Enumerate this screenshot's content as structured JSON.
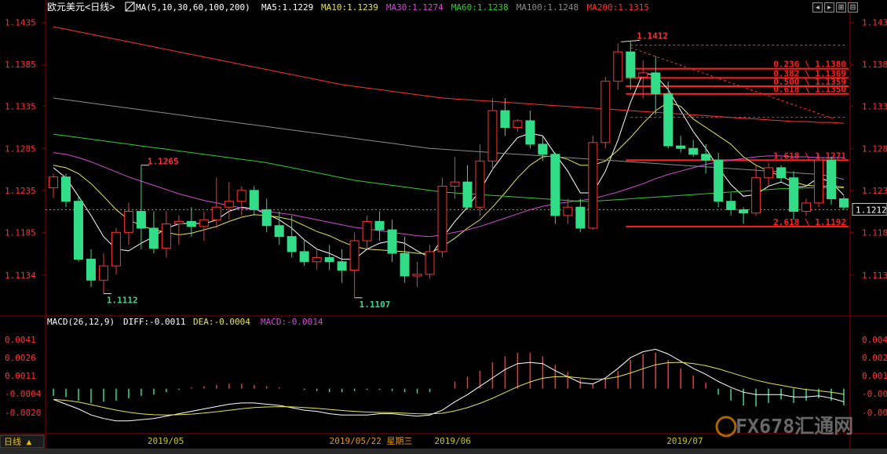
{
  "header": {
    "symbol": "欧元美元",
    "period": "<日线>",
    "ma_label": "MA(5,10,30,60,100,200)",
    "ma_values": [
      {
        "text": "MA5:1.1229",
        "color": "#ffffff"
      },
      {
        "text": "MA10:1.1239",
        "color": "#e6e64c"
      },
      {
        "text": "MA30:1.1274",
        "color": "#d24bd2"
      },
      {
        "text": "MA60:1.1238",
        "color": "#33cc33"
      },
      {
        "text": "MA100:1.1248",
        "color": "#8c8c8c"
      },
      {
        "text": "MA200:1.1315",
        "color": "#ff3232"
      }
    ]
  },
  "window_buttons": [
    "◂",
    "▸",
    "⊞",
    "⊟"
  ],
  "price_axis": {
    "ticks": [
      "1.1435",
      "1.1385",
      "1.1335",
      "1.1285",
      "1.1235",
      "1.1185",
      "1.1134"
    ],
    "current_price": "1.1212"
  },
  "macd_axis": {
    "ticks": [
      "0.0041",
      "0.0026",
      "0.0011",
      "-0.0004",
      "-0.0020"
    ]
  },
  "macd_header": {
    "label": "MACD(26,12,9)",
    "diff": "DIFF:-0.0011",
    "dea": "DEA:-0.0004",
    "macd": "MACD:-0.0014"
  },
  "annotations": {
    "high": "1.1412",
    "low1": "1.1112",
    "low2": "1.1107",
    "peak": "1.1265"
  },
  "fibonacci": [
    {
      "text": "0.236 \\ 1.1380",
      "price": 1.138
    },
    {
      "text": "0.382 \\ 1.1369",
      "price": 1.1369
    },
    {
      "text": "0.500 \\ 1.1359",
      "price": 1.1359
    },
    {
      "text": "0.618 \\ 1.1350",
      "price": 1.135
    },
    {
      "text": "1.618 \\ 1.1271",
      "price": 1.1271
    },
    {
      "text": "2.618 \\ 1.1192",
      "price": 1.1192
    }
  ],
  "date_axis": {
    "labels": [
      "2019/05",
      "2019/05/22  星期三",
      "2019/06",
      "2019/07"
    ]
  },
  "footer": {
    "period_tab": "日线 ▲",
    "watermark": "FX678汇通网"
  },
  "colors": {
    "up": "#ff3232",
    "down": "#33dd88",
    "background": "#000000",
    "grid": "#8b0000",
    "axis_text_left": "#ff3232",
    "axis_text_right": "#ff3232",
    "date_text": "#c8c800",
    "crosshair_date": "#e69900"
  },
  "chart_data": {
    "type": "candlestick",
    "ylim": [
      1.109,
      1.1445
    ],
    "candles": [
      [
        1.1238,
        1.1255,
        1.1226,
        1.1251
      ],
      [
        1.1251,
        1.1255,
        1.1215,
        1.1222
      ],
      [
        1.1222,
        1.1228,
        1.115,
        1.1153
      ],
      [
        1.1153,
        1.1165,
        1.112,
        1.1128
      ],
      [
        1.1128,
        1.116,
        1.1112,
        1.1145
      ],
      [
        1.1145,
        1.119,
        1.1135,
        1.1185
      ],
      [
        1.1185,
        1.122,
        1.117,
        1.121
      ],
      [
        1.121,
        1.1265,
        1.1165,
        1.119
      ],
      [
        1.119,
        1.121,
        1.116,
        1.1166
      ],
      [
        1.1166,
        1.121,
        1.1155,
        1.1195
      ],
      [
        1.1195,
        1.1205,
        1.117,
        1.1198
      ],
      [
        1.1198,
        1.1215,
        1.118,
        1.1192
      ],
      [
        1.1192,
        1.121,
        1.1175,
        1.12
      ],
      [
        1.12,
        1.125,
        1.119,
        1.1215
      ],
      [
        1.1215,
        1.1245,
        1.12,
        1.1222
      ],
      [
        1.1222,
        1.124,
        1.1205,
        1.1235
      ],
      [
        1.1235,
        1.124,
        1.1205,
        1.1212
      ],
      [
        1.1212,
        1.1225,
        1.1185,
        1.1193
      ],
      [
        1.1193,
        1.121,
        1.117,
        1.118
      ],
      [
        1.118,
        1.1205,
        1.1155,
        1.1162
      ],
      [
        1.1162,
        1.1175,
        1.1145,
        1.115
      ],
      [
        1.115,
        1.1165,
        1.114,
        1.1155
      ],
      [
        1.1155,
        1.117,
        1.114,
        1.115
      ],
      [
        1.115,
        1.1165,
        1.1125,
        1.114
      ],
      [
        1.114,
        1.1185,
        1.1107,
        1.1175
      ],
      [
        1.1175,
        1.1205,
        1.1165,
        1.1198
      ],
      [
        1.1198,
        1.121,
        1.1175,
        1.1188
      ],
      [
        1.1188,
        1.12,
        1.115,
        1.116
      ],
      [
        1.116,
        1.118,
        1.1125,
        1.1133
      ],
      [
        1.1133,
        1.115,
        1.112,
        1.1135
      ],
      [
        1.1135,
        1.117,
        1.113,
        1.1162
      ],
      [
        1.1162,
        1.125,
        1.1155,
        1.124
      ],
      [
        1.124,
        1.1275,
        1.1225,
        1.1245
      ],
      [
        1.1245,
        1.1265,
        1.1212,
        1.1215
      ],
      [
        1.1215,
        1.129,
        1.1205,
        1.127
      ],
      [
        1.127,
        1.1345,
        1.126,
        1.133
      ],
      [
        1.133,
        1.1345,
        1.13,
        1.131
      ],
      [
        1.131,
        1.132,
        1.1305,
        1.1318
      ],
      [
        1.1318,
        1.133,
        1.1285,
        1.129
      ],
      [
        1.129,
        1.13,
        1.127,
        1.1278
      ],
      [
        1.1278,
        1.128,
        1.1195,
        1.1205
      ],
      [
        1.1205,
        1.1225,
        1.1195,
        1.1215
      ],
      [
        1.1215,
        1.1225,
        1.1185,
        1.119
      ],
      [
        1.119,
        1.13,
        1.1188,
        1.1292
      ],
      [
        1.1292,
        1.137,
        1.1285,
        1.1365
      ],
      [
        1.1365,
        1.141,
        1.1355,
        1.14
      ],
      [
        1.14,
        1.1412,
        1.1355,
        1.137
      ],
      [
        1.137,
        1.139,
        1.1345,
        1.1375
      ],
      [
        1.1375,
        1.1395,
        1.1325,
        1.135
      ],
      [
        1.135,
        1.1365,
        1.1285,
        1.1288
      ],
      [
        1.1288,
        1.13,
        1.128,
        1.1285
      ],
      [
        1.1285,
        1.1295,
        1.1275,
        1.1278
      ],
      [
        1.1278,
        1.129,
        1.1255,
        1.1271
      ],
      [
        1.1271,
        1.128,
        1.1215,
        1.1222
      ],
      [
        1.1222,
        1.1232,
        1.1205,
        1.1212
      ],
      [
        1.1212,
        1.1215,
        1.1195,
        1.1208
      ],
      [
        1.1208,
        1.1265,
        1.1205,
        1.125
      ],
      [
        1.125,
        1.1268,
        1.124,
        1.1262
      ],
      [
        1.1262,
        1.1265,
        1.1245,
        1.125
      ],
      [
        1.125,
        1.1258,
        1.12,
        1.121
      ],
      [
        1.121,
        1.1225,
        1.1205,
        1.122
      ],
      [
        1.122,
        1.1278,
        1.1215,
        1.1271
      ],
      [
        1.1271,
        1.1275,
        1.1218,
        1.1225
      ],
      [
        1.1225,
        1.1228,
        1.1212,
        1.1215
      ]
    ],
    "ma_lines": [
      {
        "name": "MA5",
        "color": "#ffffff",
        "values": [
          1.1262,
          1.125,
          1.1228,
          1.1205,
          1.118,
          1.1165,
          1.1163,
          1.1172,
          1.118,
          1.119,
          1.1195,
          1.1196,
          1.1195,
          1.12,
          1.121,
          1.1215,
          1.1213,
          1.1207,
          1.12,
          1.119,
          1.1176,
          1.1165,
          1.116,
          1.1153,
          1.1153,
          1.1165,
          1.1172,
          1.1175,
          1.1172,
          1.1163,
          1.1155,
          1.1178,
          1.1198,
          1.1215,
          1.1235,
          1.126,
          1.128,
          1.1298,
          1.1303,
          1.13,
          1.1278,
          1.1258,
          1.1232,
          1.1232,
          1.1258,
          1.1295,
          1.134,
          1.1375,
          1.1372,
          1.1355,
          1.133,
          1.1305,
          1.1285,
          1.1262,
          1.1242,
          1.1228,
          1.123,
          1.124,
          1.1245,
          1.1238,
          1.124,
          1.125,
          1.1245,
          1.1229
        ]
      },
      {
        "name": "MA10",
        "color": "#e6e64c",
        "values": [
          1.1265,
          1.1262,
          1.1255,
          1.1243,
          1.1228,
          1.1212,
          1.12,
          1.1193,
          1.1188,
          1.1185,
          1.1182,
          1.1184,
          1.1188,
          1.1192,
          1.1198,
          1.1203,
          1.1206,
          1.1205,
          1.1203,
          1.12,
          1.1193,
          1.1186,
          1.1181,
          1.1174,
          1.1168,
          1.1165,
          1.1164,
          1.1163,
          1.1162,
          1.116,
          1.116,
          1.1168,
          1.1178,
          1.119,
          1.12,
          1.1215,
          1.1232,
          1.125,
          1.1265,
          1.1275,
          1.1276,
          1.1272,
          1.1265,
          1.1265,
          1.127,
          1.1283,
          1.1298,
          1.1315,
          1.133,
          1.134,
          1.1335,
          1.132,
          1.131,
          1.13,
          1.129,
          1.1275,
          1.1265,
          1.1258,
          1.1252,
          1.1245,
          1.1241,
          1.124,
          1.124,
          1.1239
        ]
      },
      {
        "name": "MA30",
        "color": "#d24bd2",
        "values": [
          1.128,
          1.1278,
          1.1274,
          1.1269,
          1.1263,
          1.1257,
          1.1251,
          1.1246,
          1.1241,
          1.1236,
          1.1231,
          1.1227,
          1.1223,
          1.122,
          1.1217,
          1.1214,
          1.1212,
          1.121,
          1.1208,
          1.1206,
          1.1203,
          1.12,
          1.1197,
          1.1194,
          1.1191,
          1.1189,
          1.1187,
          1.1185,
          1.1183,
          1.1181,
          1.118,
          1.1182,
          1.1185,
          1.1188,
          1.1192,
          1.1197,
          1.1202,
          1.1207,
          1.1212,
          1.1216,
          1.1219,
          1.1221,
          1.1223,
          1.1225,
          1.1229,
          1.1233,
          1.1238,
          1.1243,
          1.1249,
          1.1254,
          1.1258,
          1.1262,
          1.1266,
          1.1269,
          1.1271,
          1.1273,
          1.1275,
          1.1276,
          1.1276,
          1.1275,
          1.1275,
          1.1274,
          1.1274,
          1.1274
        ]
      },
      {
        "name": "MA60",
        "color": "#33cc33",
        "values": [
          1.1302,
          1.13,
          1.1298,
          1.1296,
          1.1294,
          1.1292,
          1.129,
          1.1288,
          1.1286,
          1.1284,
          1.1282,
          1.128,
          1.1278,
          1.1276,
          1.1274,
          1.1272,
          1.127,
          1.1268,
          1.1265,
          1.1262,
          1.1259,
          1.1256,
          1.1253,
          1.125,
          1.1247,
          1.1245,
          1.1243,
          1.1241,
          1.1239,
          1.1237,
          1.1235,
          1.1233,
          1.1232,
          1.1231,
          1.123,
          1.1229,
          1.1228,
          1.1227,
          1.1226,
          1.1225,
          1.1224,
          1.1223,
          1.1222,
          1.1222,
          1.1223,
          1.1224,
          1.1225,
          1.1226,
          1.1227,
          1.1228,
          1.1229,
          1.123,
          1.1231,
          1.1232,
          1.1233,
          1.1234,
          1.1235,
          1.1236,
          1.1237,
          1.1237,
          1.1238,
          1.1238,
          1.1238,
          1.1238
        ]
      },
      {
        "name": "MA100",
        "color": "#8c8c8c",
        "values": [
          1.1345,
          1.1343,
          1.1341,
          1.1339,
          1.1337,
          1.1335,
          1.1333,
          1.1331,
          1.1329,
          1.1327,
          1.1325,
          1.1323,
          1.1321,
          1.1319,
          1.1317,
          1.1315,
          1.1313,
          1.1311,
          1.1309,
          1.1307,
          1.1305,
          1.1303,
          1.1301,
          1.1299,
          1.1297,
          1.1295,
          1.1293,
          1.1291,
          1.1289,
          1.1287,
          1.1285,
          1.1284,
          1.1283,
          1.1282,
          1.1281,
          1.128,
          1.1279,
          1.1278,
          1.1277,
          1.1276,
          1.1275,
          1.1274,
          1.1273,
          1.1272,
          1.1271,
          1.127,
          1.1269,
          1.1268,
          1.1267,
          1.1266,
          1.1265,
          1.1264,
          1.1263,
          1.1262,
          1.1261,
          1.126,
          1.1259,
          1.1258,
          1.1257,
          1.1256,
          1.1255,
          1.1254,
          1.1252,
          1.1248
        ]
      },
      {
        "name": "MA200",
        "color": "#ff3232",
        "values": [
          1.143,
          1.1427,
          1.1424,
          1.1421,
          1.1418,
          1.1415,
          1.1412,
          1.1409,
          1.1406,
          1.1403,
          1.14,
          1.1397,
          1.1394,
          1.1391,
          1.1388,
          1.1385,
          1.1382,
          1.1379,
          1.1376,
          1.1373,
          1.137,
          1.1367,
          1.1364,
          1.1361,
          1.1359,
          1.1357,
          1.1355,
          1.1353,
          1.1351,
          1.1349,
          1.1347,
          1.1345,
          1.1344,
          1.1343,
          1.1342,
          1.1341,
          1.134,
          1.1339,
          1.1338,
          1.1337,
          1.1336,
          1.1335,
          1.1334,
          1.1333,
          1.1332,
          1.1331,
          1.133,
          1.1329,
          1.1328,
          1.1327,
          1.1326,
          1.1325,
          1.1324,
          1.1323,
          1.1322,
          1.1321,
          1.132,
          1.1319,
          1.1318,
          1.1317,
          1.1317,
          1.1316,
          1.1316,
          1.1315
        ]
      }
    ],
    "macd": {
      "ylim": [
        -0.0037,
        0.0051
      ],
      "hist": [
        -0.0006,
        -0.0007,
        -0.001,
        -0.0012,
        -0.0011,
        -0.001,
        -0.0008,
        -0.0006,
        -0.0005,
        -0.0003,
        -0.0001,
        0.0001,
        0.0002,
        0.0003,
        0.0004,
        0.0004,
        0.0003,
        0.0002,
        0.0001,
        0.0,
        -0.0001,
        -0.0002,
        -0.0003,
        -0.0003,
        -0.0002,
        -0.0001,
        -0.0001,
        -0.0002,
        -0.0003,
        -0.0004,
        -0.0003,
        0.0,
        0.0006,
        0.001,
        0.0015,
        0.0022,
        0.0027,
        0.003,
        0.003,
        0.0027,
        0.002,
        0.0014,
        0.0008,
        0.0004,
        0.0008,
        0.0015,
        0.0024,
        0.0029,
        0.003,
        0.0024,
        0.0017,
        0.0011,
        0.0005,
        -0.0005,
        -0.001,
        -0.0014,
        -0.0015,
        -0.0012,
        -0.0009,
        -0.0012,
        -0.001,
        -0.0008,
        -0.001,
        -0.0014
      ],
      "diff": [
        -0.0009,
        -0.0013,
        -0.0017,
        -0.0022,
        -0.0025,
        -0.0027,
        -0.0027,
        -0.0026,
        -0.0025,
        -0.0023,
        -0.0021,
        -0.0019,
        -0.0017,
        -0.0015,
        -0.0013,
        -0.0012,
        -0.0012,
        -0.0013,
        -0.0014,
        -0.0016,
        -0.0018,
        -0.0019,
        -0.0021,
        -0.0022,
        -0.0022,
        -0.0022,
        -0.0021,
        -0.0021,
        -0.0022,
        -0.0023,
        -0.0022,
        -0.0018,
        -0.0011,
        -0.0005,
        0.0002,
        0.0009,
        0.0016,
        0.0021,
        0.0022,
        0.0021,
        0.0015,
        0.001,
        0.0005,
        0.0004,
        0.0009,
        0.0017,
        0.0026,
        0.0031,
        0.0033,
        0.0029,
        0.0023,
        0.0017,
        0.0012,
        0.0006,
        0.0001,
        -0.0003,
        -0.0005,
        -0.0005,
        -0.0005,
        -0.0007,
        -0.0007,
        -0.0006,
        -0.0008,
        -0.0011
      ]
    }
  }
}
